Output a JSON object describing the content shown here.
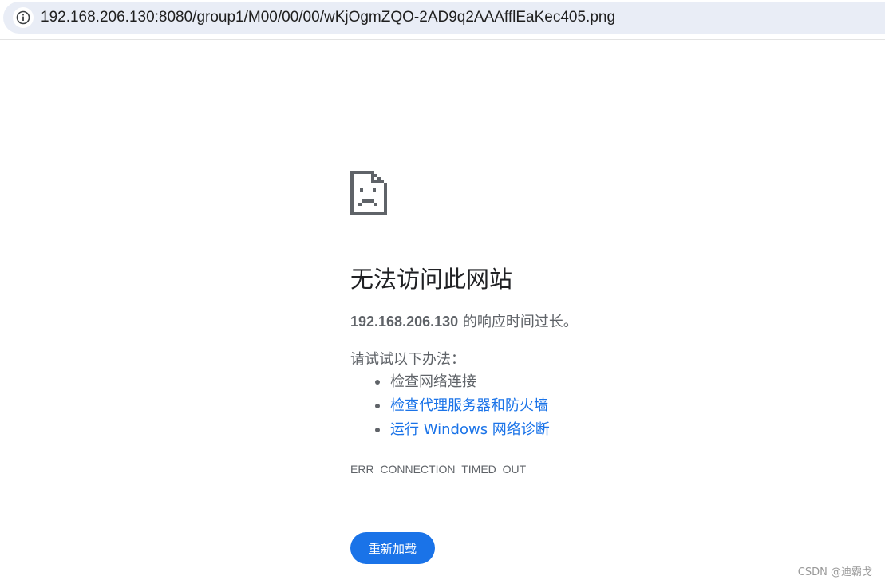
{
  "address_bar": {
    "url": "192.168.206.130:8080/group1/M00/00/00/wKjOgmZQO-2AD9q2AAAfflEaKec405.png",
    "icon": "info-icon"
  },
  "error_page": {
    "icon": "sad-page-icon",
    "heading": "无法访问此网站",
    "host": "192.168.206.130",
    "summary_suffix": " 的响应时间过长。",
    "suggestions_label": "请试试以下办法：",
    "suggestions": [
      {
        "label": "检查网络连接",
        "is_link": false
      },
      {
        "label": "检查代理服务器和防火墙",
        "is_link": true
      },
      {
        "label": "运行 Windows 网络诊断",
        "is_link": true
      }
    ],
    "error_code": "ERR_CONNECTION_TIMED_OUT",
    "reload_label": "重新加载"
  },
  "watermark": "CSDN @迪霸戈",
  "colors": {
    "accent": "#1a73e8",
    "text_secondary": "#5f6368",
    "text_primary": "#202124",
    "address_bg": "#e9edf6"
  }
}
